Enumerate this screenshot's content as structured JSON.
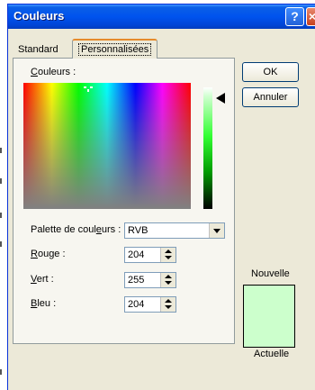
{
  "window": {
    "title": "Couleurs"
  },
  "titlebar": {
    "help_label": "?",
    "close_label": "×"
  },
  "tabs": [
    {
      "label": "Standard",
      "active": false
    },
    {
      "label": "Personnalisées",
      "active": true
    }
  ],
  "custom": {
    "colors_label_prefix": "C",
    "colors_label_rest": "ouleurs :",
    "palette_label_a": "Palette de coul",
    "palette_label_u": "e",
    "palette_label_b": "urs :",
    "palette_value": "RVB",
    "fields": [
      {
        "key": "R",
        "rest": "ouge :",
        "value": "204"
      },
      {
        "key": "V",
        "rest": "ert :",
        "value": "255"
      },
      {
        "key": "B",
        "rest": "leu :",
        "value": "204"
      }
    ]
  },
  "buttons": {
    "ok": "OK",
    "cancel": "Annuler"
  },
  "preview": {
    "new_label": "Nouvelle",
    "current_label": "Actuelle",
    "new_color": "#ccffcc",
    "current_color": "#ccffcc"
  }
}
